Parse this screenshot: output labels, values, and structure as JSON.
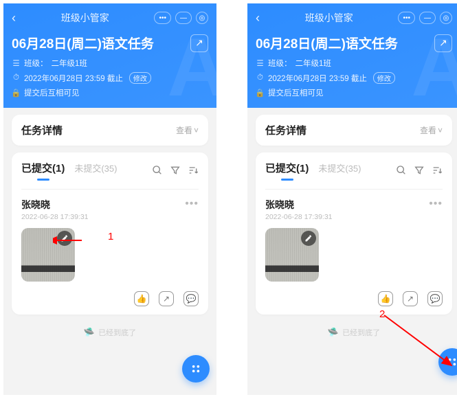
{
  "app": {
    "title": "班级小管家"
  },
  "task": {
    "title": "06月28日(周二)语文任务",
    "class_label": "班级：",
    "class_name": "二年级1班",
    "deadline": "2022年06月28日 23:59 截止",
    "modify": "修改",
    "visibility": "提交后互相可见"
  },
  "details": {
    "heading": "任务详情",
    "view": "查看"
  },
  "tabs": {
    "submitted": "已提交(1)",
    "not_submitted": "未提交(35)"
  },
  "submission": {
    "author": "张晓晓",
    "time": "2022-06-28 17:39:31"
  },
  "footer": {
    "end": "已经到底了"
  },
  "annotations": {
    "a1": "1",
    "a2": "2"
  }
}
